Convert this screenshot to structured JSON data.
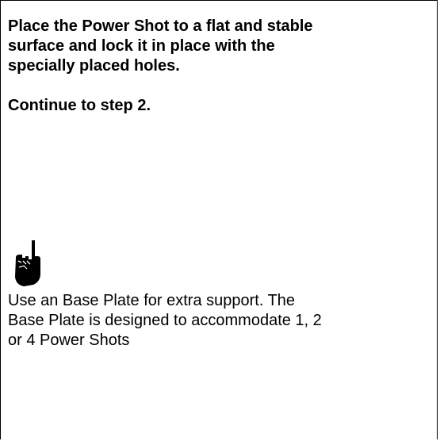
{
  "instruction": {
    "lines": [
      "Place the Power Shot to a flat and stable",
      "surface and lock it in place with the",
      "specially placed holes."
    ]
  },
  "step_note": "Continue to step 2.",
  "tip": {
    "icon": "pointing-hand-icon",
    "lines": [
      "Use an Base Plate for extra support. The",
      "Base Plate is designed to accommodate 1, 2",
      "or 4 Power Shots"
    ]
  }
}
